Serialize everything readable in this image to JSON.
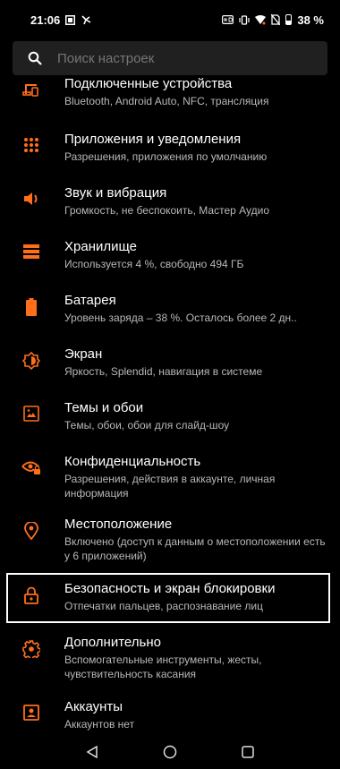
{
  "status": {
    "time": "21:06",
    "battery": "38 %",
    "accent": "#ff6e1a"
  },
  "search": {
    "placeholder": "Поиск настроек"
  },
  "items": [
    {
      "title": "Подключенные устройства",
      "subtitle": "Bluetooth, Android Auto, NFC, трансляция",
      "icon": "devices-icon"
    },
    {
      "title": "Приложения и уведомления",
      "subtitle": "Разрешения, приложения по умолчанию",
      "icon": "apps-grid-icon"
    },
    {
      "title": "Звук и вибрация",
      "subtitle": "Громкость, не беспокоить, Мастер Аудио",
      "icon": "volume-icon"
    },
    {
      "title": "Хранилище",
      "subtitle": "Используется 4 %, свободно 494 ГБ",
      "icon": "storage-icon"
    },
    {
      "title": "Батарея",
      "subtitle": "Уровень заряда – 38 %. Осталось более 2 дн..",
      "icon": "battery-icon"
    },
    {
      "title": "Экран",
      "subtitle": "Яркость, Splendid, навигация в системе",
      "icon": "brightness-icon"
    },
    {
      "title": "Темы и обои",
      "subtitle": "Темы, обои, обои для слайд-шоу",
      "icon": "wallpaper-icon"
    },
    {
      "title": "Конфиденциальность",
      "subtitle": "Разрешения, действия в аккаунте, личная информация",
      "icon": "privacy-eye-icon"
    },
    {
      "title": "Местоположение",
      "subtitle": "Включено (доступ к данным о местоположении есть у 6 приложений)",
      "icon": "location-pin-icon"
    },
    {
      "title": "Безопасность и экран блокировки",
      "subtitle": "Отпечатки пальцев, распознавание лиц",
      "icon": "lock-icon"
    },
    {
      "title": "Дополнительно",
      "subtitle": "Вспомогательные инструменты, жесты, чувствительность касания",
      "icon": "gear-icon"
    },
    {
      "title": "Аккаунты",
      "subtitle": "Аккаунтов нет",
      "icon": "account-icon"
    }
  ],
  "nav": [
    "back-icon",
    "home-icon",
    "recents-icon"
  ]
}
